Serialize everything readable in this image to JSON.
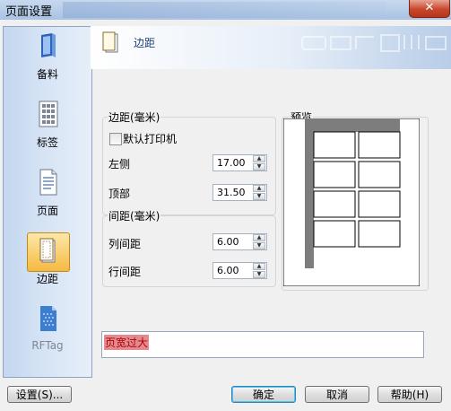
{
  "window": {
    "title": "页面设置",
    "close_glyph": "✕"
  },
  "sidebar": {
    "items": [
      {
        "label": "备料",
        "icon": "book-icon"
      },
      {
        "label": "标签",
        "icon": "label-grid-icon"
      },
      {
        "label": "页面",
        "icon": "page-icon"
      },
      {
        "label": "边距",
        "icon": "margin-icon"
      },
      {
        "label": "RFTag",
        "icon": "rftag-icon"
      }
    ],
    "active_index": 3
  },
  "header": {
    "title": "边距"
  },
  "margins": {
    "group_title": "边距(毫米)",
    "default_printer_label": "默认打印机",
    "default_printer_checked": false,
    "left_label": "左侧",
    "left_value": "17.00",
    "top_label": "顶部",
    "top_value": "31.50"
  },
  "spacing": {
    "group_title": "间距(毫米)",
    "col_label": "列间距",
    "col_value": "6.00",
    "row_label": "行间距",
    "row_value": "6.00"
  },
  "preview": {
    "group_title": "预览",
    "label_columns": 2,
    "label_rows": 4
  },
  "error": {
    "message": "页宽过大"
  },
  "buttons": {
    "setup": "设置(S)...",
    "ok": "确定",
    "cancel": "取消",
    "help": "帮助(H)"
  },
  "colors": {
    "error_highlight": "#e28a90",
    "active_nav": "#f5b942",
    "accent": "#1f3f7a"
  }
}
